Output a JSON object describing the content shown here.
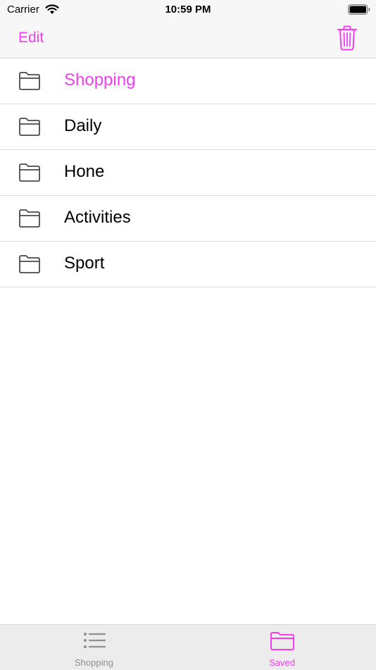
{
  "status_bar": {
    "carrier": "Carrier",
    "time": "10:59 PM"
  },
  "nav": {
    "edit_label": "Edit",
    "trash_icon": "trash-icon"
  },
  "colors": {
    "accent": "#f23ef0",
    "inactive": "#8e8e93",
    "icon_gray": "#4a4a4a"
  },
  "list": {
    "items": [
      {
        "label": "Shopping",
        "icon": "folder-icon",
        "selected": true
      },
      {
        "label": "Daily",
        "icon": "folder-icon",
        "selected": false
      },
      {
        "label": "Hone",
        "icon": "folder-icon",
        "selected": false
      },
      {
        "label": "Activities",
        "icon": "folder-icon",
        "selected": false
      },
      {
        "label": "Sport",
        "icon": "folder-icon",
        "selected": false
      }
    ]
  },
  "tabs": [
    {
      "label": "Shopping",
      "icon": "list-icon",
      "active": false
    },
    {
      "label": "Saved",
      "icon": "folder-icon",
      "active": true
    }
  ]
}
